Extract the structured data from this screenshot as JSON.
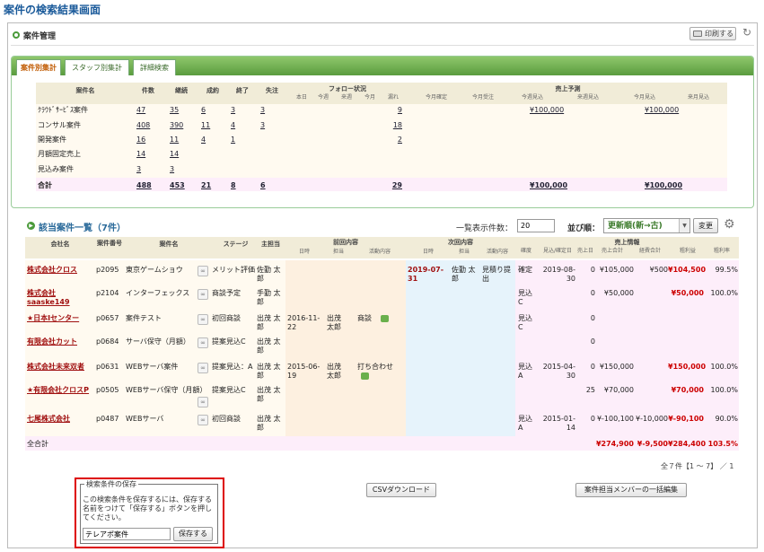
{
  "heading": "案件の検索結果画面",
  "management": {
    "title": "案件管理",
    "print_label": "印刷する"
  },
  "tabs": [
    {
      "label": "案件別集計",
      "active": true
    },
    {
      "label": "スタッフ別集計",
      "active": false
    },
    {
      "label": "詳細検索",
      "active": false
    }
  ],
  "summary": {
    "headers": {
      "name": "案件名",
      "count": "件数",
      "continue": "継続",
      "won": "成約",
      "ended": "終了",
      "lost": "失注",
      "follow": "フォロー状況",
      "sales": "売上予測"
    },
    "follow_sub": [
      "本日",
      "今週",
      "来週",
      "今月",
      "漏れ"
    ],
    "sales_sub": [
      "今月確定",
      "今月受注",
      "今週見込",
      "来週見込",
      "今月見込",
      "来月見込"
    ],
    "rows": [
      {
        "name": "ｸﾗｳﾄﾞｻｰﾋﾞｽ案件",
        "count": "47",
        "cont": "35",
        "won": "6",
        "ended": "3",
        "lost": "3",
        "leak": "9",
        "weekfc": "¥100,000",
        "monthfc": "¥100,000"
      },
      {
        "name": "コンサル案件",
        "count": "408",
        "cont": "390",
        "won": "11",
        "ended": "4",
        "lost": "3",
        "leak": "18",
        "weekfc": "",
        "monthfc": ""
      },
      {
        "name": "開発案件",
        "count": "16",
        "cont": "11",
        "won": "4",
        "ended": "1",
        "lost": "",
        "leak": "2",
        "weekfc": "",
        "monthfc": ""
      },
      {
        "name": "月額固定売上",
        "count": "14",
        "cont": "14",
        "won": "",
        "ended": "",
        "lost": "",
        "leak": "",
        "weekfc": "",
        "monthfc": ""
      },
      {
        "name": "見込み案件",
        "count": "3",
        "cont": "3",
        "won": "",
        "ended": "",
        "lost": "",
        "leak": "",
        "weekfc": "",
        "monthfc": ""
      }
    ],
    "total": {
      "name": "合計",
      "count": "488",
      "cont": "453",
      "won": "21",
      "ended": "8",
      "lost": "6",
      "leak": "29",
      "weekfc": "¥100,000",
      "monthfc": "¥100,000"
    }
  },
  "list": {
    "title": "該当案件一覧（7件）",
    "per_page_label": "一覧表示件数：",
    "per_page_value": "20",
    "sort_label": "並び順：",
    "sort_value": "更新順(新→古)",
    "change_label": "変更",
    "headers": {
      "company": "会社名",
      "no": "案件番号",
      "case": "案件名",
      "stage": "ステージ",
      "owner": "主担当",
      "prev": "前回内容",
      "next": "次回内容",
      "salesinfo": "売上情報"
    },
    "prev_sub": [
      "日時",
      "担当",
      "活動内容"
    ],
    "next_sub": [
      "日時",
      "担当",
      "活動内容"
    ],
    "sales_sub": [
      "確度",
      "見込/確定日",
      "売上日",
      "売上合計",
      "経費合計",
      "粗利益",
      "粗利率"
    ],
    "rows": [
      {
        "company": "株式会社クロス",
        "no": "p2095",
        "case": "東京ゲームショウ",
        "stage": "メリット評価",
        "owner": "佐勤 太郎",
        "pdate": "",
        "powner": "",
        "pact": "",
        "ndate": "2019-07-31",
        "nowner": "佐勤 太郎",
        "nact": "見積り提出",
        "prob": "確定",
        "sdate": "2019-08-30",
        "sday": "0",
        "stotal": "¥105,000",
        "cost": "¥500",
        "profit": "¥104,500",
        "rate": "99.5%"
      },
      {
        "company": "株式会社saaske149",
        "no": "p2104",
        "case": "インターフェックス",
        "stage": "商談予定",
        "owner": "手勤 太郎",
        "pdate": "",
        "powner": "",
        "pact": "",
        "ndate": "",
        "nowner": "",
        "nact": "",
        "prob": "見込C",
        "sdate": "",
        "sday": "0",
        "stotal": "¥50,000",
        "cost": "",
        "profit": "¥50,000",
        "rate": "100.0%"
      },
      {
        "company": "★日本Iセンター",
        "no": "p0657",
        "case": "案件テスト",
        "stage": "初回商談",
        "owner": "出茂 太郎",
        "pdate": "2016-11-22",
        "powner": "出茂 太郎",
        "pact": "商談",
        "ndate": "",
        "nowner": "",
        "nact": "",
        "prob": "見込C",
        "sdate": "",
        "sday": "0",
        "stotal": "",
        "cost": "",
        "profit": "",
        "rate": ""
      },
      {
        "company": "有限会社カット",
        "no": "p0684",
        "case": "サーバ保守（月額）",
        "stage": "提案見込C",
        "owner": "出茂 太郎",
        "pdate": "",
        "powner": "",
        "pact": "",
        "ndate": "",
        "nowner": "",
        "nact": "",
        "prob": "",
        "sdate": "",
        "sday": "0",
        "stotal": "",
        "cost": "",
        "profit": "",
        "rate": ""
      },
      {
        "company": "株式会社未来双者",
        "no": "p0631",
        "case": "WEBサーバ案件",
        "stage": "提案見込：A",
        "owner": "出茂 太郎",
        "pdate": "2015-06-19",
        "powner": "出茂 太郎",
        "pact": "打ち合わせ",
        "ndate": "",
        "nowner": "",
        "nact": "",
        "prob": "見込A",
        "sdate": "2015-04-30",
        "sday": "0",
        "stotal": "¥150,000",
        "cost": "",
        "profit": "¥150,000",
        "rate": "100.0%"
      },
      {
        "company": "★有限会社クロスP",
        "no": "p0505",
        "case": "WEBサーバ保守（月額）",
        "stage": "提案見込C",
        "owner": "出茂 太郎",
        "pdate": "",
        "powner": "",
        "pact": "",
        "ndate": "",
        "nowner": "",
        "nact": "",
        "prob": "",
        "sdate": "",
        "sday": "25",
        "stotal": "¥70,000",
        "cost": "",
        "profit": "¥70,000",
        "rate": "100.0%"
      },
      {
        "company": "七尾株式会社",
        "no": "p0487",
        "case": "WEBサーバ",
        "stage": "初回商談",
        "owner": "出茂 太郎",
        "pdate": "",
        "powner": "",
        "pact": "",
        "ndate": "",
        "nowner": "",
        "nact": "",
        "prob": "見込A",
        "sdate": "2015-01-14",
        "sday": "0",
        "stotal": "¥-100,100",
        "cost": "¥-10,000",
        "profit": "¥-90,100",
        "rate": "90.0%"
      }
    ],
    "total": {
      "label": "全合計",
      "stotal": "¥274,900",
      "cost": "¥-9,500",
      "profit": "¥284,400",
      "rate": "103.5%"
    },
    "pager": "全７件【1 ～ 7】 ／ 1"
  },
  "save": {
    "title": "検索条件の保存",
    "description": "この検索条件を保存するには、保存する名前をつけて「保存する」ボタンを押してください。",
    "input_value": "テレアポ案件",
    "button_label": "保存する"
  },
  "csv_label": "CSVダウンロード",
  "bulk_edit_label": "案件担当メンバーの一括編集",
  "colors": {
    "accent_green": "#5a9c3e",
    "heading_blue": "#1a5a9a",
    "highlight_red": "#d00000"
  }
}
